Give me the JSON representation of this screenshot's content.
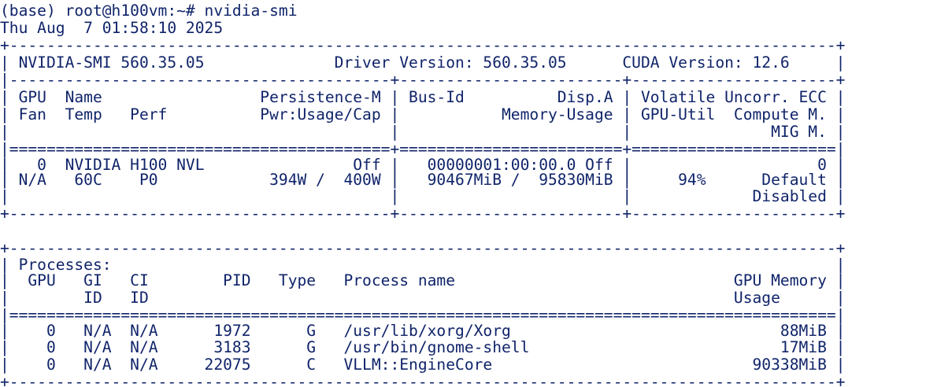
{
  "prompt": "(base) root@h100vm:~# nvidia-smi",
  "timestamp": "Thu Aug  7 01:58:10 2025",
  "gpu_table": {
    "border_top": "+-----------------------------------------------------------------------------------------+",
    "version_row": "| NVIDIA-SMI 560.35.05              Driver Version: 560.35.05      CUDA Version: 12.6     |",
    "divider_version": "|-----------------------------------------+------------------------+----------------------+",
    "header_row_1": "| GPU  Name                 Persistence-M | Bus-Id          Disp.A | Volatile Uncorr. ECC |",
    "header_row_2": "| Fan  Temp   Perf          Pwr:Usage/Cap |           Memory-Usage | GPU-Util  Compute M. |",
    "header_row_3": "|                                         |                        |               MIG M. |",
    "header_separator": "|=========================================+========================+======================|",
    "gpu_row_1": "|   0  NVIDIA H100 NVL                Off |   00000001:00:00.0 Off |                    0 |",
    "gpu_row_2": "| N/A   60C    P0            394W /  400W |   90467MiB /  95830MiB |     94%      Default |",
    "gpu_row_3": "|                                         |                        |             Disabled |",
    "border_bottom": "+-----------------------------------------+------------------------+----------------------+"
  },
  "process_table": {
    "border_top": "+-----------------------------------------------------------------------------------------+",
    "title_row": "| Processes:                                                                              |",
    "header_row_1": "|  GPU   GI   CI        PID   Type   Process name                              GPU Memory |",
    "header_row_2": "|        ID   ID                                                               Usage      |",
    "header_separator": "|=========================================================================================|",
    "rows": [
      "|    0   N/A  N/A      1972      G   /usr/lib/xorg/Xorg                             88MiB |",
      "|    0   N/A  N/A      3183      G   /usr/bin/gnome-shell                           17MiB |",
      "|    0   N/A  N/A     22075      C   VLLM::EngineCore                            90338MiB |"
    ],
    "border_bottom": "+-----------------------------------------------------------------------------------------+"
  }
}
